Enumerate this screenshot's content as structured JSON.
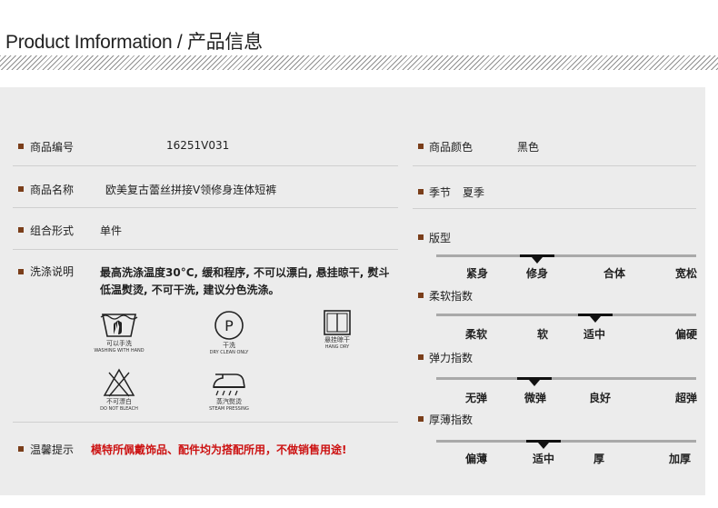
{
  "header": {
    "title": "Product Imformation / 产品信息"
  },
  "left": {
    "code": {
      "label": "商品编号",
      "value": "16251V031"
    },
    "name": {
      "label": "商品名称",
      "value": "欧美复古蕾丝拼接V领修身连体短裤"
    },
    "combo": {
      "label": "组合形式",
      "value": "单件"
    },
    "wash": {
      "label": "洗涤说明",
      "text": "最高洗涤温度30°C, 缓和程序, 不可以漂白, 悬挂晾干, 熨斗低温熨烫, 不可干洗, 建议分色洗涤。",
      "icons": [
        {
          "icon": "hand-wash-icon",
          "cn": "可以手洗",
          "en": "WASHING WITH HAND"
        },
        {
          "icon": "dry-clean-icon",
          "cn": "干洗",
          "en": "DRY CLEAN ONLY"
        },
        {
          "icon": "hang-dry-icon",
          "cn": "悬挂晾干",
          "en": "HANG DRY"
        },
        {
          "icon": "no-bleach-icon",
          "cn": "不可漂白",
          "en": "DO NOT BLEACH"
        },
        {
          "icon": "steam-iron-icon",
          "cn": "蒸汽熨烫",
          "en": "STEAM PRESSING"
        }
      ]
    },
    "tips": {
      "label": "温馨提示",
      "text": "模特所佩戴饰品、配件均为搭配所用，不做销售用途!"
    }
  },
  "right": {
    "color": {
      "label": "商品颜色",
      "value": "黑色"
    },
    "season": {
      "label": "季节",
      "value": "夏季"
    },
    "scales": [
      {
        "label": "版型",
        "options": [
          "紧身",
          "修身",
          "合体",
          "宽松"
        ],
        "selected": 1
      },
      {
        "label": "柔软指数",
        "options": [
          "柔软",
          "软",
          "适中",
          "偏硬"
        ],
        "selected": 2
      },
      {
        "label": "弹力指数",
        "options": [
          "无弹",
          "微弹",
          "良好",
          "超弹"
        ],
        "selected": 1
      },
      {
        "label": "厚薄指数",
        "options": [
          "偏薄",
          "适中",
          "厚",
          "加厚"
        ],
        "selected": 1
      }
    ]
  },
  "colors": {
    "bullet": "#7a3e1a",
    "panel": "#ececec",
    "warning": "#cc1111",
    "scale_bar": "#a9a9a9",
    "scale_selected": "#111111"
  }
}
